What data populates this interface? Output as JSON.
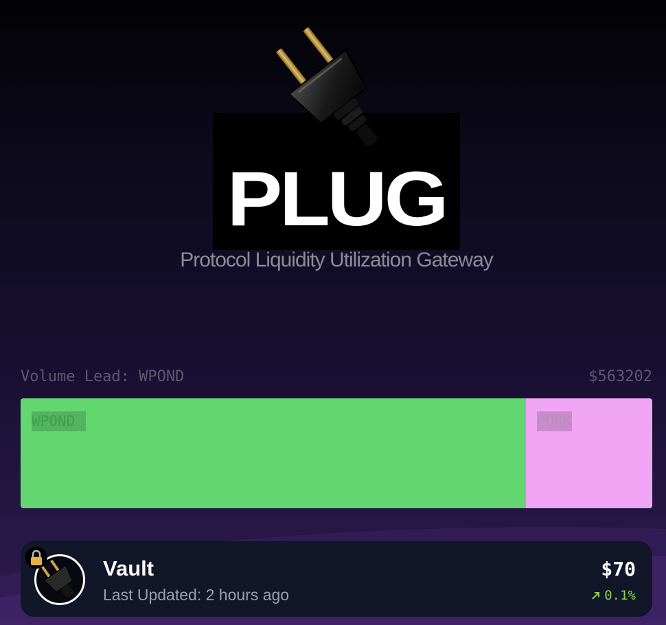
{
  "brand": {
    "name": "PLUG",
    "tagline": "Protocol Liquidity Utilization Gateway"
  },
  "volume": {
    "lead_label": "Volume Lead: WPOND",
    "total": "$563202",
    "segments": [
      {
        "name": "WPOND",
        "share": 0.8,
        "color": "#64d670",
        "label_color": "#3da04a"
      },
      {
        "name": "PORK",
        "share": 0.2,
        "color": "#f0a6f5",
        "label_color": "#b88fb9"
      }
    ]
  },
  "vault_card": {
    "title": "Vault",
    "updated": "Last Updated: 2 hours ago",
    "value": "$70",
    "change": "0.1%",
    "change_icon": "arrow-up-right-icon",
    "lock_icon": "lock-icon",
    "avatar_icon": "plug-icon",
    "change_color": "#8fd14a"
  }
}
